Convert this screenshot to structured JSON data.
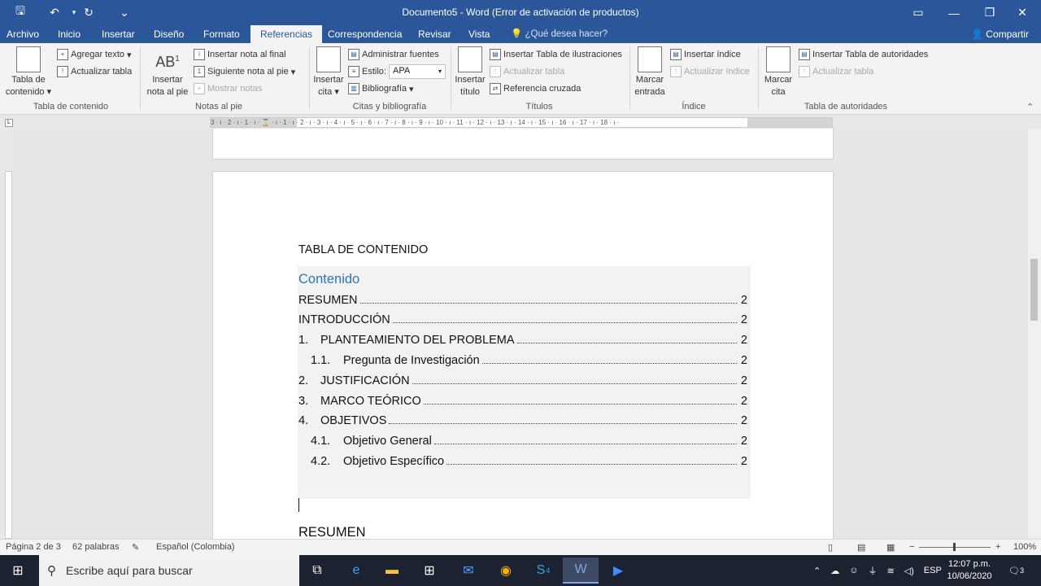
{
  "window": {
    "title": "Documento5 - Word (Error de activación de productos)"
  },
  "quick_access": {
    "save": "🖫",
    "undo": "↶",
    "redo": "↻",
    "customize": "⌄"
  },
  "window_controls": {
    "ribbon_options": "▭",
    "minimize": "—",
    "maximize": "❐",
    "close": "✕"
  },
  "menu_tabs": [
    "Archivo",
    "Inicio",
    "Insertar",
    "Diseño",
    "Formato",
    "Referencias",
    "Correspondencia",
    "Revisar",
    "Vista"
  ],
  "tell_me": "¿Qué desea hacer?",
  "share": "Compartir",
  "ribbon": {
    "toc": {
      "big_label": "Tabla de contenido",
      "add_text": "Agregar texto",
      "update_table": "Actualizar tabla",
      "group": "Tabla de contenido"
    },
    "footnotes": {
      "big_label": "Insertar nota al pie",
      "insert_endnote": "Insertar nota al final",
      "next_footnote": "Siguiente nota al pie",
      "show_notes": "Mostrar notas",
      "group": "Notas al pie"
    },
    "citations": {
      "big_label": "Insertar cita",
      "manage_sources": "Administrar fuentes",
      "style_label": "Estilo:",
      "style_value": "APA",
      "bibliography": "Bibliografía",
      "group": "Citas y bibliografía"
    },
    "captions": {
      "big_label": "Insertar título",
      "insert_table_figures": "Insertar Tabla de ilustraciones",
      "update_table": "Actualizar tabla",
      "cross_reference": "Referencia cruzada",
      "group": "Títulos"
    },
    "index": {
      "big_label": "Marcar entrada",
      "insert_index": "Insertar índice",
      "update_index": "Actualizar índice",
      "group": "Índice"
    },
    "authorities": {
      "big_label": "Marcar cita",
      "insert_table_auth": "Insertar Tabla de autoridades",
      "update_table": "Actualizar tabla",
      "group": "Tabla de autoridades"
    }
  },
  "ruler": {
    "ticks": "3 · ı · 2 · ı · 1 · ı · ⌛ · ı · 1 · ı · 2 · ı · 3 · ı · 4 · ı · 5 · ı · 6 · ı · 7 · ı · 8 · ı · 9 · ı · 10 · ı · 11 · ı · 12 · ı · 13 · ı · 14 · ı · 15 · ı · 16 · ı · 17 · ı · 18 · ı ·"
  },
  "document": {
    "heading": "TABLA DE CONTENIDO",
    "toc_title": "Contenido",
    "toc_entries": [
      {
        "num": "",
        "label": "RESUMEN",
        "page": "2"
      },
      {
        "num": "",
        "label": "INTRODUCCIÓN",
        "page": "2"
      },
      {
        "num": "1.",
        "label": "PLANTEAMIENTO DEL PROBLEMA",
        "page": "2"
      },
      {
        "num": "1.1.",
        "label": "Pregunta de Investigación",
        "page": "2"
      },
      {
        "num": "2.",
        "label": "JUSTIFICACIÓN",
        "page": "2"
      },
      {
        "num": "3.",
        "label": "MARCO TEÓRICO",
        "page": "2"
      },
      {
        "num": "4.",
        "label": "OBJETIVOS",
        "page": "2"
      },
      {
        "num": "4.1.",
        "label": "Objetivo General",
        "page": "2"
      },
      {
        "num": "4.2.",
        "label": "Objetivo Específico",
        "page": "2"
      }
    ],
    "next_heading": "RESUMEN"
  },
  "status": {
    "page": "Página 2 de 3",
    "words": "62 palabras",
    "language": "Español (Colombia)",
    "zoom": "100%"
  },
  "taskbar": {
    "search_placeholder": "Escribe aquí para buscar",
    "skype_badge": "4",
    "language": "ESP",
    "time": "12:07 p.m.",
    "date": "10/06/2020",
    "notif_count": "3"
  }
}
